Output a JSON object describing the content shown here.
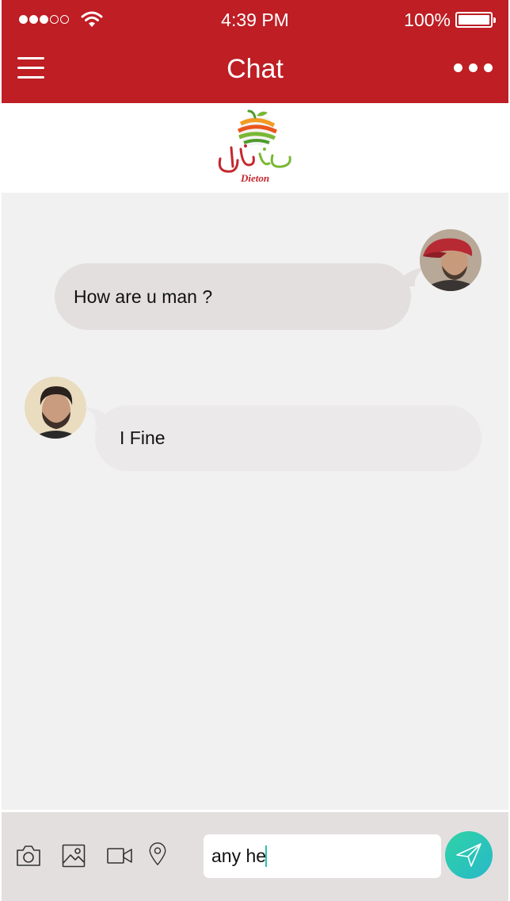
{
  "status_bar": {
    "time": "4:39 PM",
    "battery": "100%",
    "signal_bars_filled": 3,
    "signal_bars_total": 5
  },
  "header": {
    "title": "Chat",
    "menu_icon": "hamburger-menu-icon",
    "more_icon": "more-dots-icon"
  },
  "brand": {
    "name": "Dieton",
    "arabic_name": "دايتون"
  },
  "messages": [
    {
      "sender": "me",
      "text": "How are u man ?"
    },
    {
      "sender": "other",
      "text": "I Fine"
    }
  ],
  "composer": {
    "value": "any he",
    "tools": [
      "camera-icon",
      "image-icon",
      "video-icon",
      "location-pin-icon"
    ],
    "send_icon": "send-icon"
  },
  "colors": {
    "header": "#be1e24",
    "chat_background": "#f1f1f1",
    "bubble": "#e3dfdf",
    "send_gradient_start": "#2fd3a6",
    "send_gradient_end": "#28b8c9"
  }
}
